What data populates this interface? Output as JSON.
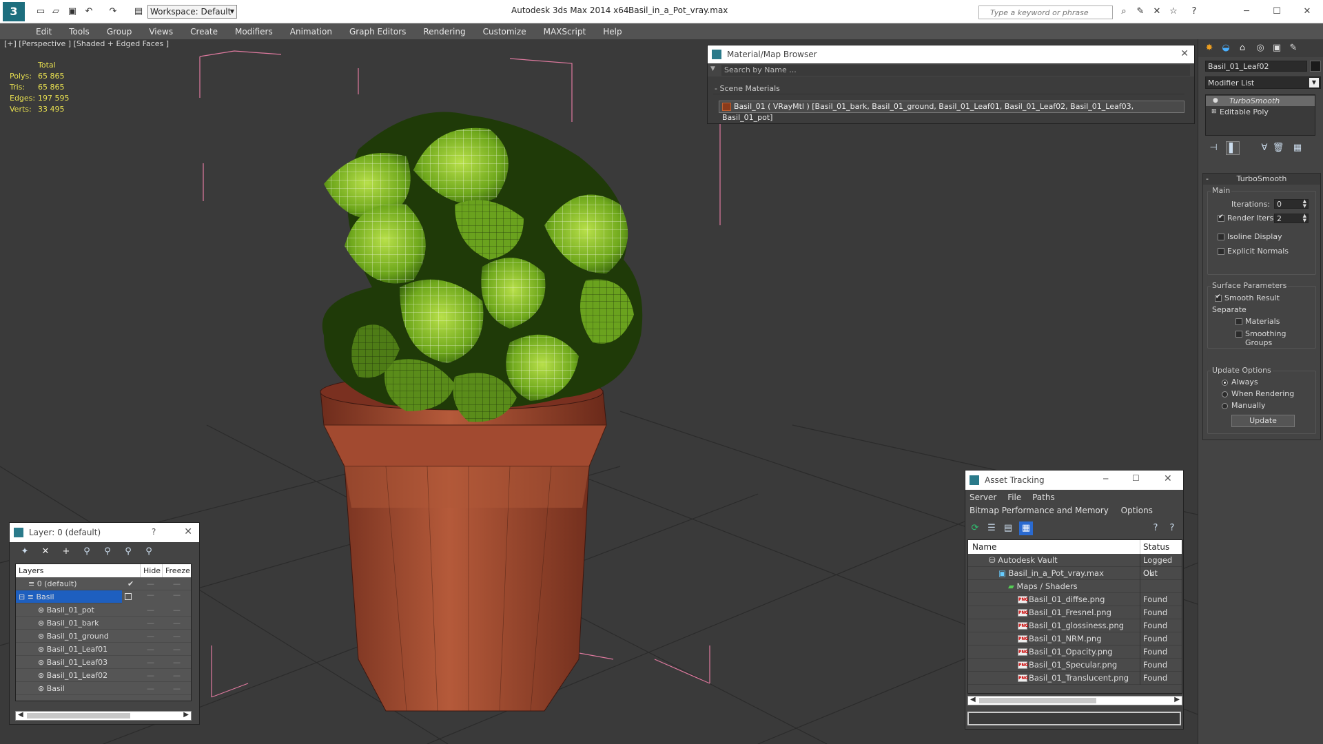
{
  "titlebar": {
    "workspace_label": "Workspace: Default",
    "app_title": "Autodesk 3ds Max  2014 x64",
    "file_title": "Basil_in_a_Pot_vray.max",
    "search_placeholder": "Type a keyword or phrase"
  },
  "menu": [
    "Edit",
    "Tools",
    "Group",
    "Views",
    "Create",
    "Modifiers",
    "Animation",
    "Graph Editors",
    "Rendering",
    "Customize",
    "MAXScript",
    "Help"
  ],
  "viewport": {
    "label": "[+] [Perspective ] [Shaded + Edged Faces ]",
    "stats": {
      "header": "Total",
      "polys_label": "Polys:",
      "polys": "65 865",
      "tris_label": "Tris:",
      "tris": "65 865",
      "edges_label": "Edges:",
      "edges": "197 595",
      "verts_label": "Verts:",
      "verts": "33 495"
    }
  },
  "material_browser": {
    "title": "Material/Map Browser",
    "search_placeholder": "Search by Name ...",
    "section": "- Scene Materials",
    "material": "Basil_01  ( VRayMtl )  [Basil_01_bark, Basil_01_ground, Basil_01_Leaf01, Basil_01_Leaf02, Basil_01_Leaf03, Basil_01_pot]"
  },
  "command_panel": {
    "object_name": "Basil_01_Leaf02",
    "modifier_list": "Modifier List",
    "stack": [
      "TurboSmooth",
      "Editable Poly"
    ],
    "rollout_title": "TurboSmooth",
    "main_group": "Main",
    "iterations_label": "Iterations:",
    "iterations": "0",
    "render_iters_label": "Render Iters:",
    "render_iters": "2",
    "isoline": "Isoline Display",
    "explicit_normals": "Explicit Normals",
    "surface_group": "Surface Parameters",
    "smooth_result": "Smooth Result",
    "separate": "Separate",
    "materials": "Materials",
    "smoothing_groups": "Smoothing Groups",
    "update_group": "Update Options",
    "always": "Always",
    "when_rendering": "When Rendering",
    "manually": "Manually",
    "update_btn": "Update"
  },
  "layer_window": {
    "title": "Layer: 0 (default)",
    "help": "?",
    "col_layers": "Layers",
    "col_hide": "Hide",
    "col_freeze": "Freeze",
    "rows": [
      "0 (default)",
      "Basil",
      "Basil_01_pot",
      "Basil_01_bark",
      "Basil_01_ground",
      "Basil_01_Leaf01",
      "Basil_01_Leaf03",
      "Basil_01_Leaf02",
      "Basil"
    ]
  },
  "asset_tracking": {
    "title": "Asset Tracking",
    "menu1": [
      "Server",
      "File",
      "Paths"
    ],
    "menu2": [
      "Bitmap Performance and Memory",
      "Options"
    ],
    "col_name": "Name",
    "col_status": "Status",
    "rows": [
      {
        "name": "Autodesk Vault",
        "status": "Logged Out"
      },
      {
        "name": "Basil_in_a_Pot_vray.max",
        "status": "Ok"
      },
      {
        "name": "Maps / Shaders",
        "status": ""
      },
      {
        "name": "Basil_01_diffse.png",
        "status": "Found"
      },
      {
        "name": "Basil_01_Fresnel.png",
        "status": "Found"
      },
      {
        "name": "Basil_01_glossiness.png",
        "status": "Found"
      },
      {
        "name": "Basil_01_NRM.png",
        "status": "Found"
      },
      {
        "name": "Basil_01_Opacity.png",
        "status": "Found"
      },
      {
        "name": "Basil_01_Specular.png",
        "status": "Found"
      },
      {
        "name": "Basil_01_Translucent.png",
        "status": "Found"
      }
    ],
    "png_badge": "PNG"
  }
}
